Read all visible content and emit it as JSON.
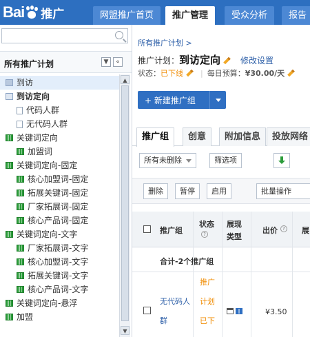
{
  "header": {
    "logo_text": "Bai",
    "logo_suffix": "推广",
    "tabs": [
      {
        "label": "网盟推广首页"
      },
      {
        "label": "推广管理"
      },
      {
        "label": "受众分析"
      },
      {
        "label": "报告"
      }
    ],
    "active_tab": "推广管理",
    "colors": {
      "bar": "#2d6fc0",
      "tab": "#4c88d4"
    }
  },
  "sidebar": {
    "search_placeholder": "",
    "title": "所有推广计划",
    "collapse_label": "«",
    "items": [
      {
        "label": "到访",
        "icon": "folder-icon"
      },
      {
        "label": "到访定向",
        "icon": "folder-open-icon"
      },
      {
        "label": "代码人群",
        "icon": "document-icon"
      },
      {
        "label": "无代码人群",
        "icon": "document-icon"
      },
      {
        "label": "关键词定向",
        "icon": "keyword-group-icon"
      },
      {
        "label": "加盟词",
        "icon": "keyword-group-icon"
      },
      {
        "label": "关键词定向-固定",
        "icon": "keyword-group-icon"
      },
      {
        "label": "核心加盟词-固定",
        "icon": "keyword-group-icon"
      },
      {
        "label": "拓展关键词-固定",
        "icon": "keyword-group-icon"
      },
      {
        "label": "厂家拓展词-固定",
        "icon": "keyword-group-icon"
      },
      {
        "label": "核心产品词-固定",
        "icon": "keyword-group-icon"
      },
      {
        "label": "关键词定向-文字",
        "icon": "keyword-group-icon"
      },
      {
        "label": "厂家拓展词-文字",
        "icon": "keyword-group-icon"
      },
      {
        "label": "核心加盟词-文字",
        "icon": "keyword-group-icon"
      },
      {
        "label": "拓展关键词-文字",
        "icon": "keyword-group-icon"
      },
      {
        "label": "核心产品词-文字",
        "icon": "keyword-group-icon"
      },
      {
        "label": "关键词定向-悬浮",
        "icon": "keyword-group-icon"
      },
      {
        "label": "加盟",
        "icon": "keyword-group-icon"
      }
    ]
  },
  "main": {
    "breadcrumb": "所有推广计划 >",
    "plan_label": "推广计划：",
    "plan_name": "到访定向",
    "edit_settings": "修改设置",
    "status_label": "状态：",
    "status_value": "已下线",
    "budget_label": "每日预算：",
    "budget_value": "¥30.00/天",
    "new_group_button": "+ 新建推广组",
    "tabs": [
      {
        "label": "推广组"
      },
      {
        "label": "创意"
      },
      {
        "label": "附加信息"
      },
      {
        "label": "投放网络"
      }
    ],
    "filter_select": "所有未删除",
    "filter_button": "筛选项",
    "actions": {
      "delete": "删除",
      "pause": "暂停",
      "enable": "启用",
      "batch": "批量操作"
    },
    "table": {
      "headers": {
        "name": "推广组",
        "status": "状态",
        "display": "展现",
        "display2": "类型",
        "bid": "出价",
        "more": "展"
      },
      "summary": "合计-2个推广组",
      "rows": [
        {
          "name_line1": "无代码人",
          "name_line2": "群",
          "status_lines": [
            "推广",
            "计划",
            "已下"
          ],
          "bid": "¥3.50"
        }
      ]
    }
  }
}
